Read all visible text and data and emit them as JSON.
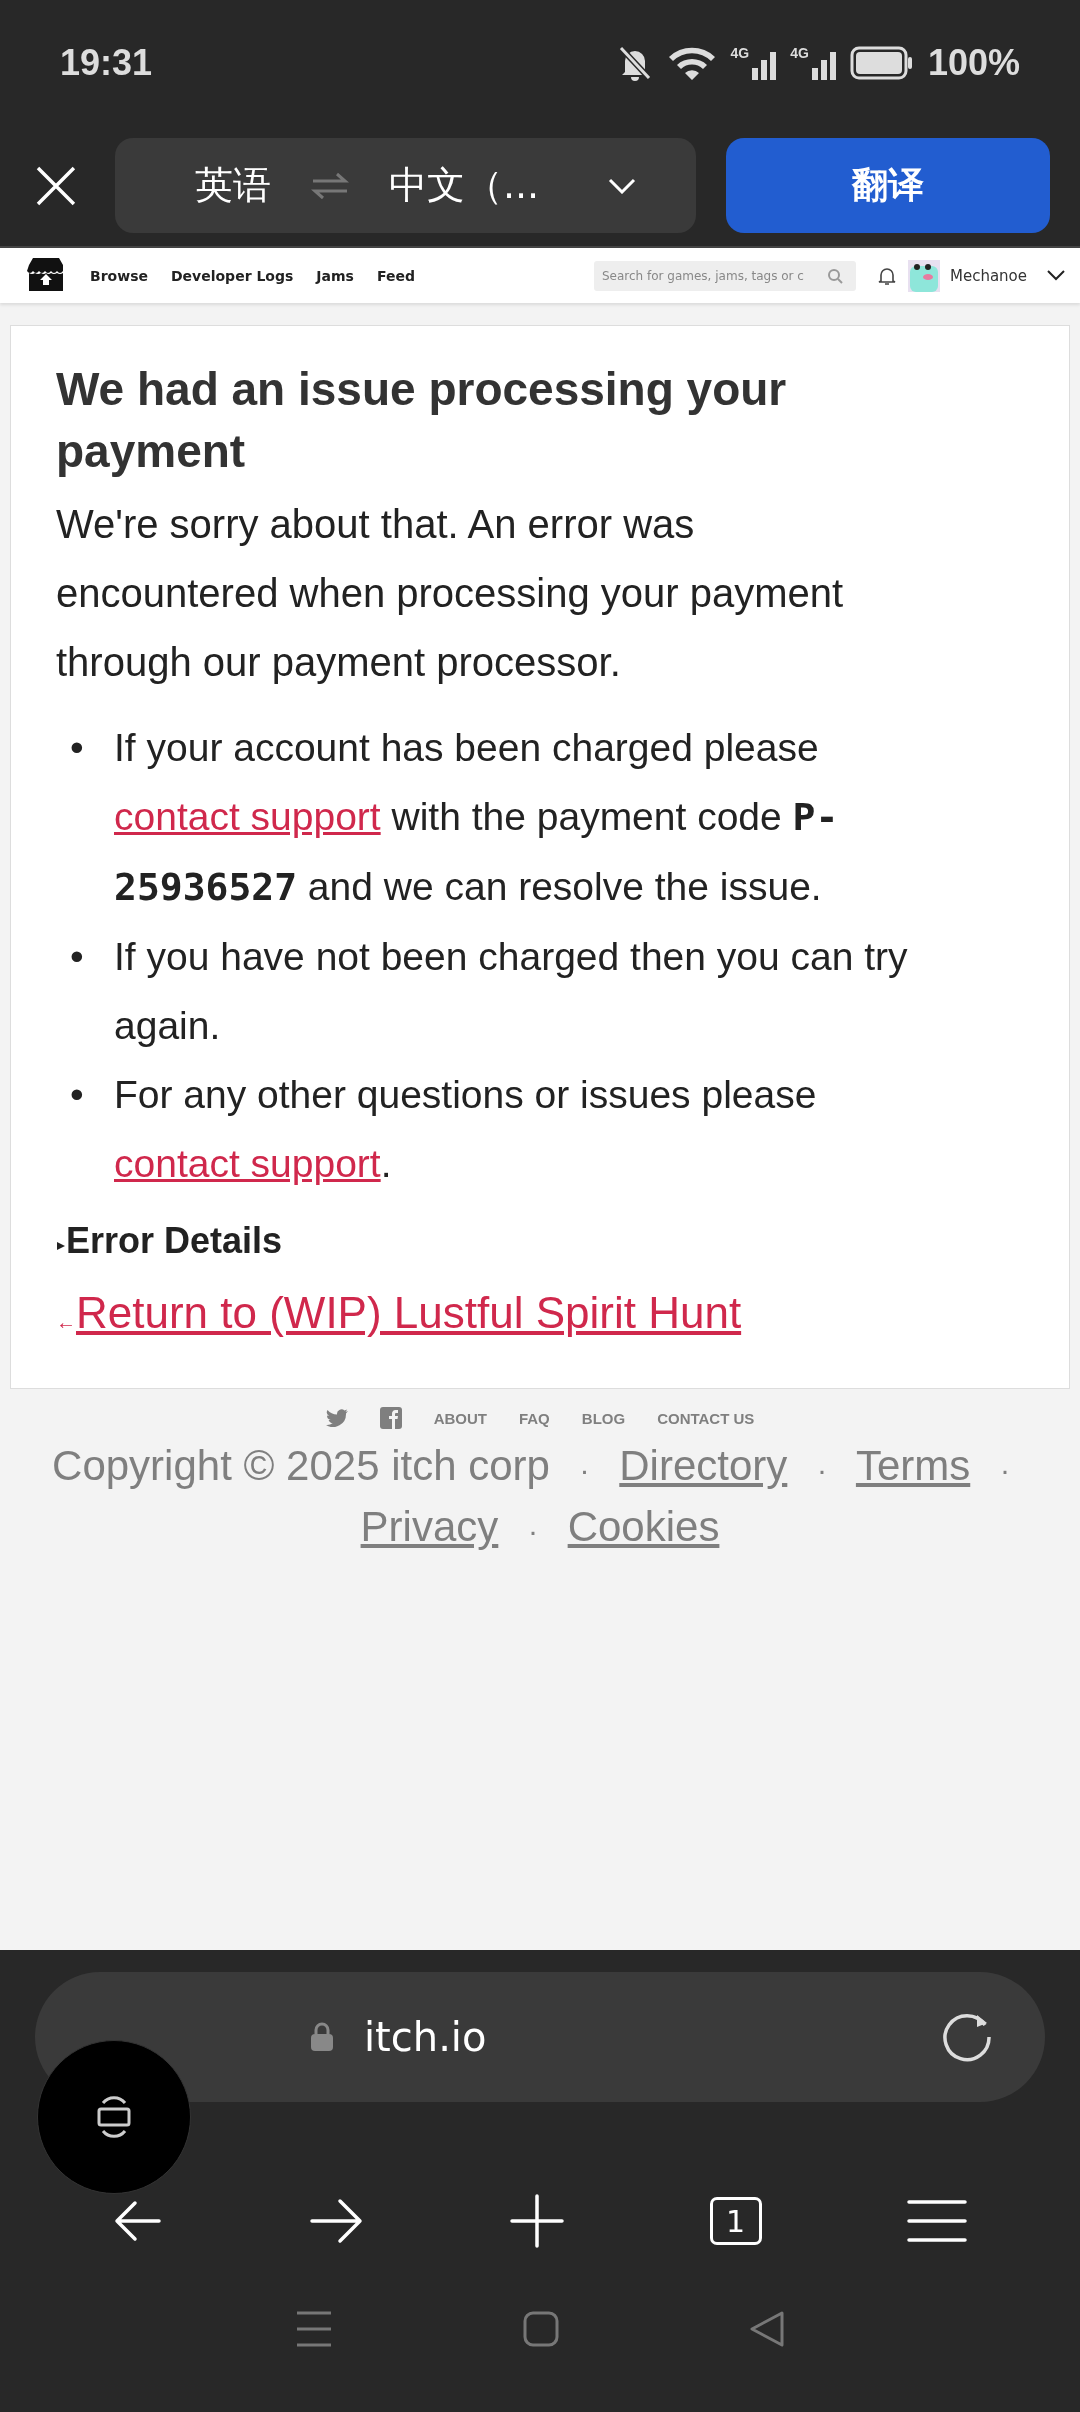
{
  "status_bar": {
    "time": "19:31",
    "network_labels": [
      "4G",
      "4G"
    ],
    "battery": "100%"
  },
  "translate_bar": {
    "source_language": "英语",
    "target_language": "中文（...",
    "translate_button": "翻译"
  },
  "site_header": {
    "nav": [
      "Browse",
      "Developer Logs",
      "Jams",
      "Feed"
    ],
    "search": {
      "placeholder": "Search for games, jams, tags or c"
    },
    "username": "Mechanoe"
  },
  "card": {
    "title": "We had an issue processing your payment",
    "intro": "We're sorry about that. An error was encountered when processing your payment through our payment processor.",
    "bullets": [
      {
        "marker": "•",
        "segments": [
          {
            "kind": "text",
            "text": "If your account has been charged please "
          },
          {
            "kind": "link",
            "text": "contact support"
          },
          {
            "kind": "text",
            "text": " with the payment code "
          },
          {
            "kind": "code",
            "text": "P-25936527"
          },
          {
            "kind": "text",
            "text": " and we can resolve the issue."
          }
        ]
      },
      {
        "marker": "•",
        "segments": [
          {
            "kind": "text",
            "text": "If you have not been charged then you can try again."
          }
        ]
      },
      {
        "marker": "•",
        "segments": [
          {
            "kind": "text",
            "text": "For any other questions or issues please "
          },
          {
            "kind": "link",
            "text": "contact support"
          },
          {
            "kind": "text",
            "text": "."
          }
        ]
      }
    ],
    "details": {
      "summary": "Error Details",
      "expanded": false
    },
    "return_link": {
      "arrow": "←",
      "text": "Return to (WIP) Lustful Spirit Hunt"
    }
  },
  "footer": {
    "links": [
      "ABOUT",
      "FAQ",
      "BLOG",
      "CONTACT US"
    ],
    "legal": [
      {
        "kind": "text",
        "text": "Copyright © 2025 itch corp"
      },
      {
        "kind": "separator",
        "text": "·"
      },
      {
        "kind": "link",
        "text": "Directory"
      },
      {
        "kind": "separator",
        "text": "·"
      },
      {
        "kind": "link",
        "text": "Terms"
      },
      {
        "kind": "separator",
        "text": "·"
      },
      {
        "kind": "link",
        "text": "Privacy"
      },
      {
        "kind": "separator",
        "text": "·"
      },
      {
        "kind": "link",
        "text": "Cookies"
      }
    ]
  },
  "browser": {
    "url": "itch.io",
    "tab_count": "1"
  }
}
